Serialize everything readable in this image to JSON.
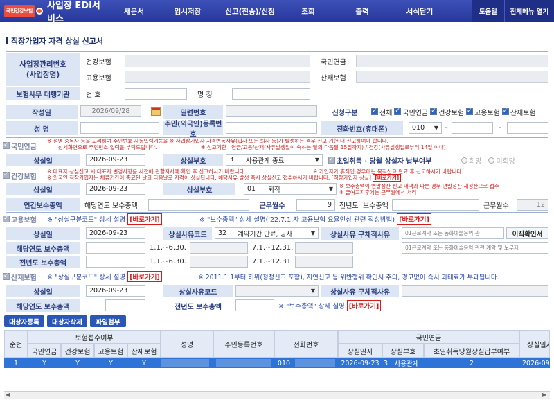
{
  "app": {
    "logo_text": "국민건강보험",
    "title": "사업장 EDI서비스"
  },
  "nav": [
    "새문서",
    "임시저장",
    "신고(전송)/신청",
    "조회",
    "출력",
    "서식닫기"
  ],
  "top_buttons": {
    "help": "도움말",
    "all_menu": "전체메뉴 열기"
  },
  "page_title": "직장가입자 자격 상실 신고서",
  "business": {
    "label_mgmt_no": "사업장관리번호\n(사업장명)",
    "health_ins": "건강보험",
    "employ_ins": "고용보험",
    "national_pension": "국민연금",
    "industrial_ins": "산재보험",
    "agency_label": "보험사무 대행기관",
    "agency_no_label": "번 호",
    "agency_name_label": "명 칭"
  },
  "form": {
    "date_label": "작성일",
    "date_value": "2026/09/28",
    "serial_label": "일련번호",
    "report_type_label": "신청구분",
    "report_types": [
      "전체",
      "국민연금",
      "건강보험",
      "고용보험",
      "산재보험"
    ],
    "name_label": "성   명",
    "rrn_label": "주민(외국인)등록번호",
    "phone_label": "전화번호(휴대폰)",
    "phone_prefix": "010",
    "phone_sep": "-"
  },
  "pension": {
    "header": "국민연금",
    "note1": "※ 성명 중복자 등을 고려하여 주민번호 자동입력기능을 ※ 사업장가입자 자격변동사유(입사 또는 퇴사 등)가 발생하는 경우 신고 기한 내 신고하여야 합니다.",
    "note2a": "상세화면으로 주민번호 입력을 부탁드립니다.",
    "note2b": "※ 신고기한 : 연금/고용/산재(사유발생일이 속하는 달의 다음달 15일까지) / 건강(사유발생일로부터 14일 이내)",
    "loss_date_label": "상실일",
    "loss_date": "2026-09-23",
    "loss_code_label": "상실부호",
    "loss_code": "3",
    "loss_code_text": "사용관계 종료",
    "first_month_label": "초일취득 · 당월 상실자 납부여부",
    "opt_yes": "희망",
    "opt_no": "미희망"
  },
  "health": {
    "header": "건강보험",
    "note1": "※ 대표자 상실신고 시 대표자 변경사항을 사전에 관할지사에 확인 후 신고하시기 바랍니다.",
    "note1b": "※ 가입자가 휴직인 경우에는 복직신고 완료 후 신고하시기 바랍니다.",
    "note2": "※ 외국인 직장가입자는 체류기간이 종료된 날의 다음날로 자격이 상실됩니다. 해당사유 발생 즉시 상실신고 접수하시기 바랍니다. [직장가입자 상실]",
    "note2_link": "[바로가기]",
    "note3": "※ 보수총액이 연말정산 신고 내역과 다른 경우 연말정산 재정산으로 접수",
    "note4": "※ 급여고지후에는 근무월에서 처리",
    "loss_date_label": "상실일",
    "loss_date": "2026-09-23",
    "loss_code_label": "상실부호",
    "loss_code": "01",
    "loss_code_text": "퇴직",
    "annual_label": "연간보수총액",
    "cur_year_label": "해당연도",
    "total_label": "보수총액",
    "work_months_label": "근무월수",
    "work_months_cur": "9",
    "prev_year_label": "전년도",
    "prev_total_label": "보수총액",
    "work_months_prev_label": "근무월수",
    "work_months_prev": "12"
  },
  "employment": {
    "header": "고용보험",
    "note_a": "※ \"상실구분코드\" 상세 설명",
    "note_b": "※ \"보수총액\" 상세 설명('22.7.1.자 고용보험 요율인상 관련 작성방법)",
    "link": "[바로가기]",
    "loss_date_label": "상실일",
    "loss_date": "2026-09-23",
    "reason_code_label": "상실사유코드",
    "reason_code": "32",
    "reason_code_text": "계약기간 만료, 공사",
    "reason_detail_label": "상실사유 구체적사유",
    "reason_detail_value": "01근로계약 또는 동화예술용역 관",
    "detail_text_value": "01근로계약 또는 동화예술용역 관련 계약 및 노무제",
    "check_history_btn": "이직확인서",
    "cur_year_total_label": "해당연도 보수총액",
    "prev_year_total_label": "전년도 보수총액",
    "period1": "1.1.~6.30.",
    "period2": "7.1.~12.31."
  },
  "industrial": {
    "header": "산재보험",
    "note_a": "※ \"상실구분코드\" 상세 설명",
    "link": "[바로가기]",
    "note_b": "※ 2011.1.1부터 허위(정정신고 포함), 지연신고 등 위반행위 확인시 주의, 경고없이 즉시 과태료가 부과됩니다.",
    "loss_date_label": "상실일",
    "loss_date": "2026-09-23",
    "reason_code_label": "상실사유코드",
    "reason_detail_label": "상실사유 구체적사유",
    "cur_year_total_label": "해당연도 보수총액",
    "prev_year_total_label": "전년도 보수총액",
    "note_c": "※ \"보수총액\" 상세 설명"
  },
  "actions": {
    "add": "대상자등록",
    "delete": "대상자삭제",
    "attach": "파일첨부"
  },
  "grid": {
    "col_no": "순번",
    "col_ins_group": "보험접수여부",
    "col_pension": "국민연금",
    "col_health": "건강보험",
    "col_employ": "고용보험",
    "col_industrial": "산재보험",
    "col_name": "성명",
    "col_rrn": "주민등록번호",
    "col_phone": "전화번호",
    "col_np_group": "국민연금",
    "col_loss_date": "상실일자",
    "col_loss_code": "상실부호",
    "col_first_month": "초일취득당월상실납부여부",
    "col_loss_date2": "상실일자",
    "row": {
      "no": "1",
      "pension": "Y",
      "health": "Y",
      "employ": "Y",
      "industrial": "Y",
      "phone": "010",
      "loss_date": "2026-09-23",
      "loss_code": "3",
      "loss_code_text": "사용관계",
      "first_month": "2",
      "loss_date2": "2026-09-"
    }
  }
}
